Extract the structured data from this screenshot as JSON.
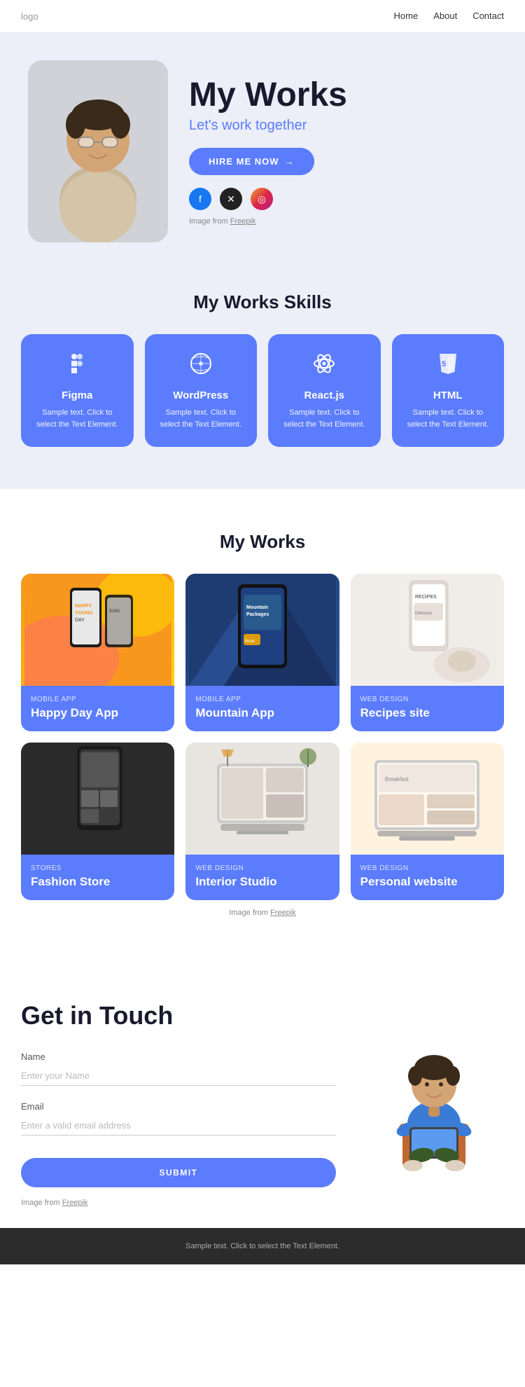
{
  "nav": {
    "logo": "logo",
    "links": [
      {
        "label": "Home",
        "href": "#"
      },
      {
        "label": "About",
        "href": "#"
      },
      {
        "label": "Contact",
        "href": "#"
      }
    ]
  },
  "hero": {
    "heading": "My Works",
    "subtitle": "Let's work together",
    "hire_btn": "HIRE ME NOW",
    "credit_prefix": "Image from ",
    "credit_link": "Freepik"
  },
  "skills_section": {
    "title": "My Works Skills",
    "cards": [
      {
        "icon": "figma",
        "name": "Figma",
        "desc": "Sample text. Click to select the Text Element."
      },
      {
        "icon": "wordpress",
        "name": "WordPress",
        "desc": "Sample text. Click to select the Text Element."
      },
      {
        "icon": "reactjs",
        "name": "React.js",
        "desc": "Sample text. Click to select the Text Element."
      },
      {
        "icon": "html",
        "name": "HTML",
        "desc": "Sample text. Click to select the Text Element."
      }
    ]
  },
  "works_section": {
    "title": "My Works",
    "cards": [
      {
        "category": "MOBILE APP",
        "title": "Happy Day App",
        "thumb_type": "happy"
      },
      {
        "category": "MOBILE APP",
        "title": "Mountain App",
        "thumb_type": "mountain"
      },
      {
        "category": "WEB DESIGN",
        "title": "Recipes site",
        "thumb_type": "recipes"
      },
      {
        "category": "STORES",
        "title": "Fashion Store",
        "thumb_type": "fashion"
      },
      {
        "category": "WEB DESIGN",
        "title": "Interior Studio",
        "thumb_type": "interior"
      },
      {
        "category": "WEB DESIGN",
        "title": "Personal website",
        "thumb_type": "personal"
      }
    ],
    "credit_prefix": "Image from ",
    "credit_link": "Freepik"
  },
  "contact": {
    "title": "Get in Touch",
    "name_label": "Name",
    "name_placeholder": "Enter your Name",
    "email_label": "Email",
    "email_placeholder": "Enter a valid email address",
    "submit_btn": "SUBMIT",
    "credit_prefix": "Image from ",
    "credit_link": "Freepik"
  },
  "footer": {
    "text": "Sample text. Click to select the Text Element."
  }
}
